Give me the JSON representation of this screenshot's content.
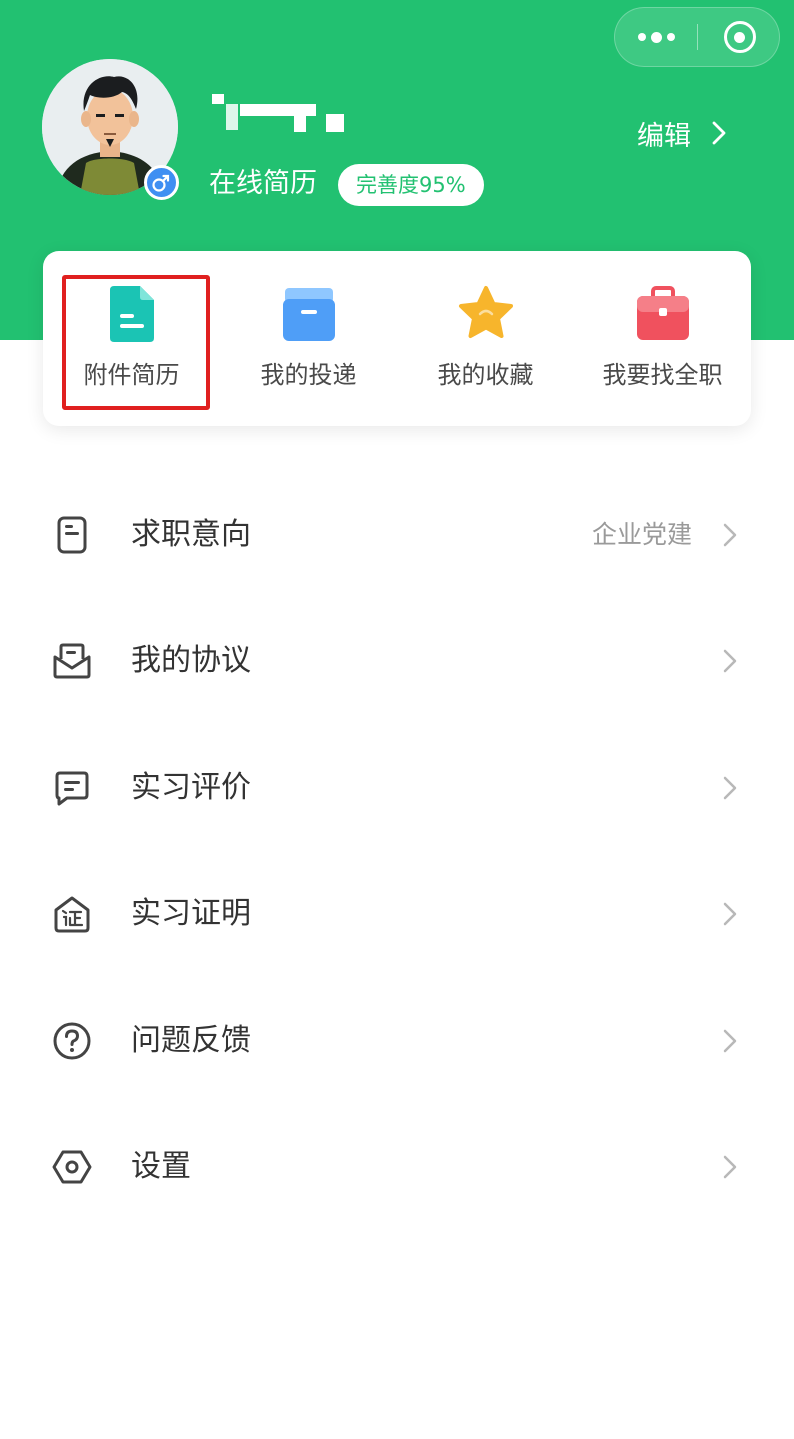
{
  "colors": {
    "brand_green": "#22c171",
    "badge_blue": "#3f8ff2",
    "highlight_red": "#e0201f"
  },
  "capsule": {
    "more_icon": "more-dots-icon",
    "close_icon": "mini-program-close-icon"
  },
  "profile": {
    "resume_label": "在线简历",
    "completion": "完善度95%",
    "edit_label": "编辑",
    "gender_icon": "male-icon"
  },
  "quick_actions": [
    {
      "label": "附件简历",
      "icon": "document-icon"
    },
    {
      "label": "我的投递",
      "icon": "box-icon"
    },
    {
      "label": "我的收藏",
      "icon": "star-icon"
    },
    {
      "label": "我要找全职",
      "icon": "briefcase-icon"
    }
  ],
  "menu": [
    {
      "label": "求职意向",
      "value": "企业党建",
      "icon": "intention-doc-icon"
    },
    {
      "label": "我的协议",
      "value": "",
      "icon": "agreement-envelope-icon"
    },
    {
      "label": "实习评价",
      "value": "",
      "icon": "comment-icon"
    },
    {
      "label": "实习证明",
      "value": "",
      "icon": "certificate-icon"
    },
    {
      "label": "问题反馈",
      "value": "",
      "icon": "question-icon"
    },
    {
      "label": "设置",
      "value": "",
      "icon": "settings-hexagon-icon"
    }
  ]
}
